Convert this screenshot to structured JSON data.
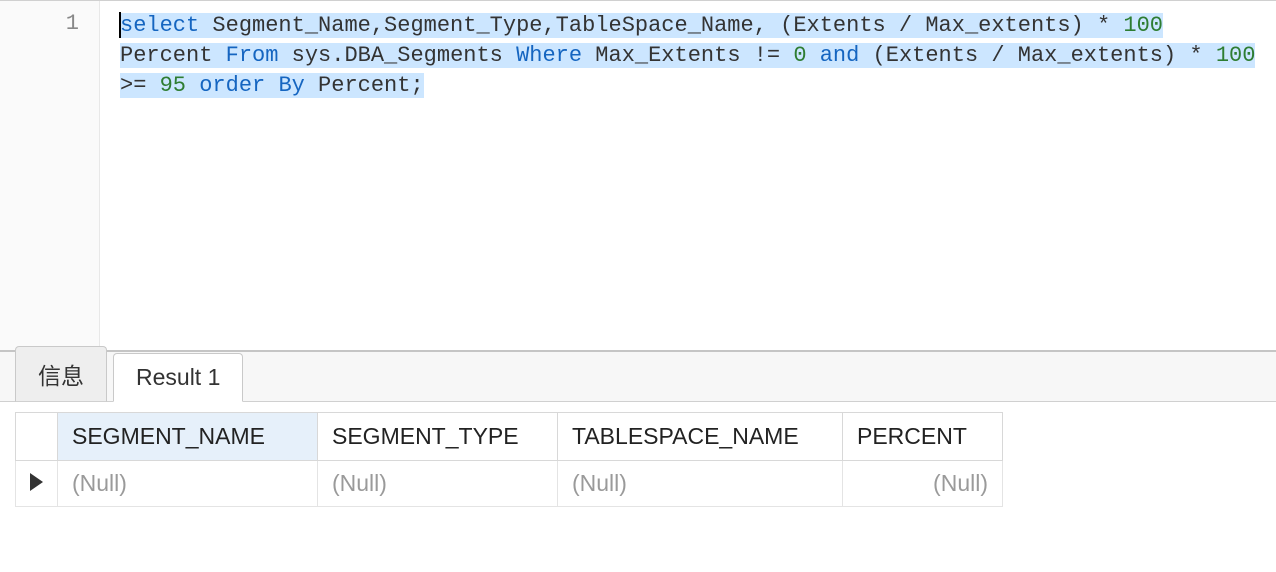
{
  "editor": {
    "line_number": "1",
    "tokens": {
      "t0": "select",
      "t1": " Segment_Name,Segment_Type,TableSpace_Name, (Extents / Max_extents) * ",
      "t2": "100",
      "t3": " Percent ",
      "t4": "From",
      "t5": " sys.DBA_Segments ",
      "t6": "Where",
      "t7": " Max_Extents != ",
      "t8": "0",
      "t9": " ",
      "t10": "and",
      "t11": " (Extents / Max_extents) * ",
      "t12": "100",
      "t13": " >= ",
      "t14": "95",
      "t15": " ",
      "t16": "order",
      "t17": " ",
      "t18": "By",
      "t19": " Percent;"
    }
  },
  "tabs": {
    "messages": "信息",
    "result": "Result 1"
  },
  "columns": {
    "c0": "SEGMENT_NAME",
    "c1": "SEGMENT_TYPE",
    "c2": "TABLESPACE_NAME",
    "c3": "PERCENT"
  },
  "row": {
    "v0": "(Null)",
    "v1": "(Null)",
    "v2": "(Null)",
    "v3": "(Null)"
  }
}
